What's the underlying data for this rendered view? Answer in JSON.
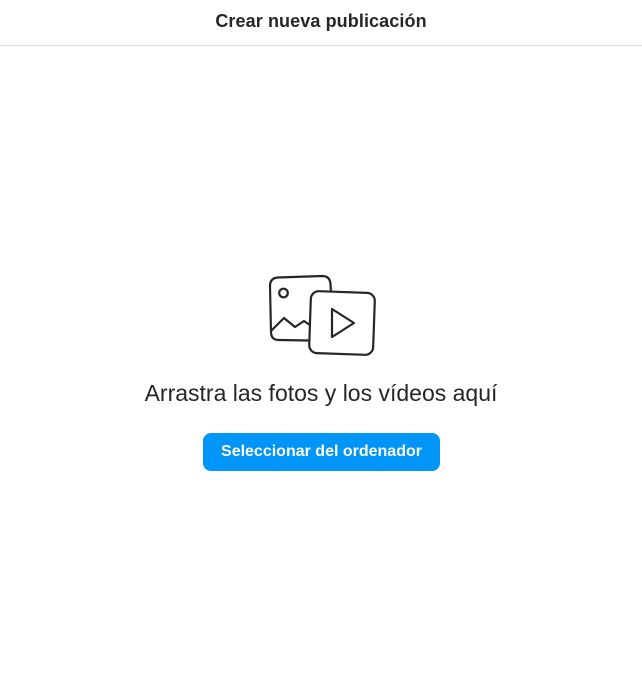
{
  "header": {
    "title": "Crear nueva publicación"
  },
  "dropzone": {
    "icon": "media-photo-video-icon",
    "prompt": "Arrastra las fotos y los vídeos aquí",
    "select_button_label": "Seleccionar del ordenador"
  },
  "colors": {
    "accent": "#0095f6",
    "text": "#262626",
    "divider": "#dbdbdb",
    "background": "#ffffff"
  }
}
